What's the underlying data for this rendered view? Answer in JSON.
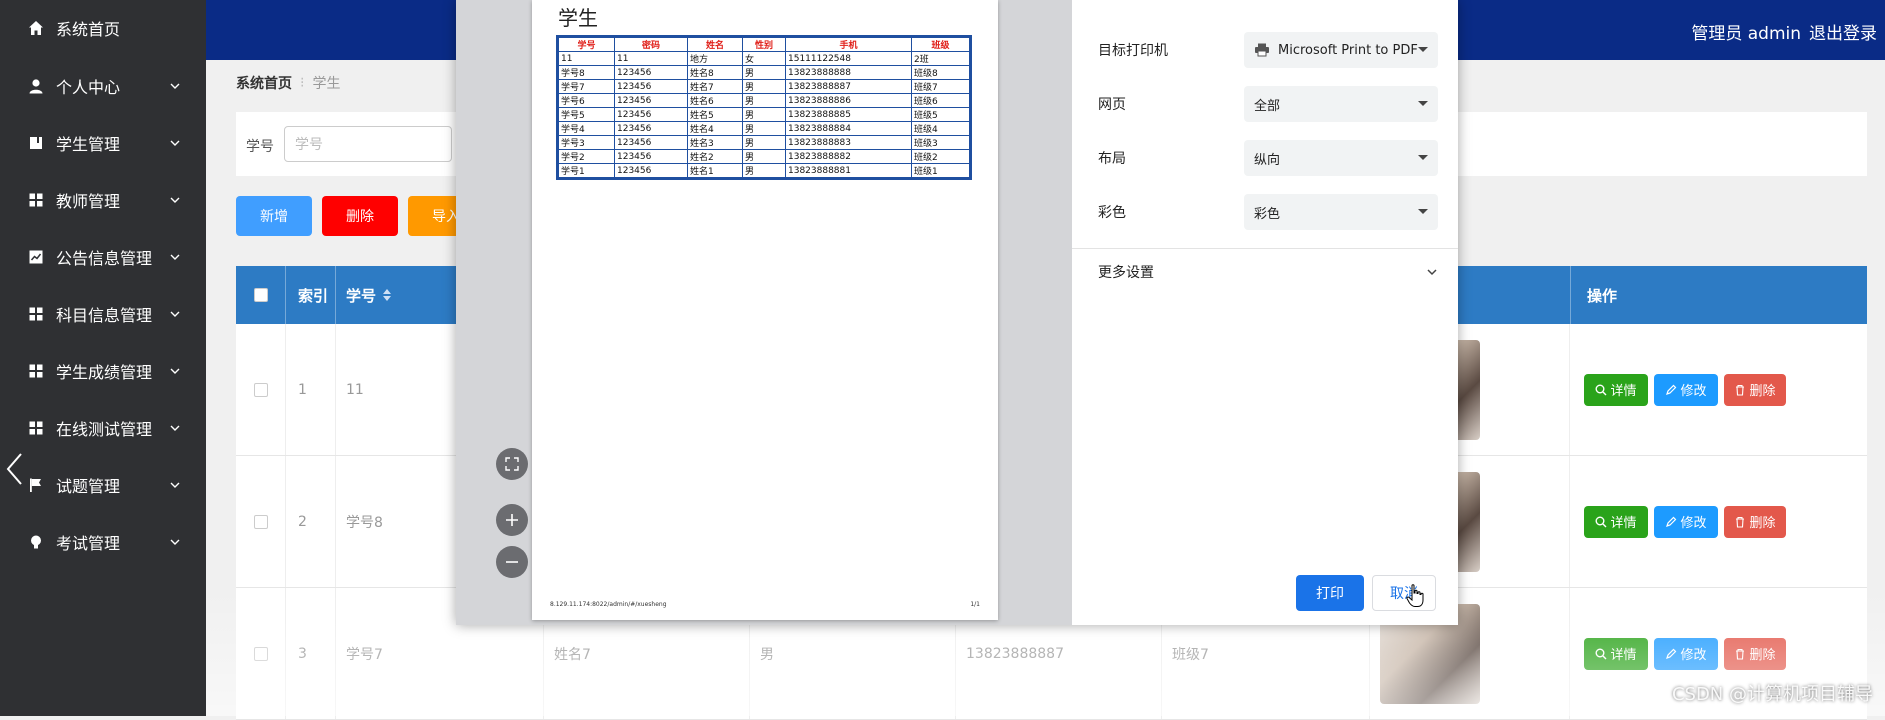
{
  "sidebar": {
    "items": [
      {
        "label": "系统首页",
        "icon": "home-icon"
      },
      {
        "label": "个人中心",
        "icon": "user-icon"
      },
      {
        "label": "学生管理",
        "icon": "book-icon"
      },
      {
        "label": "教师管理",
        "icon": "grid-icon"
      },
      {
        "label": "公告信息管理",
        "icon": "chart-icon"
      },
      {
        "label": "科目信息管理",
        "icon": "grid-icon"
      },
      {
        "label": "学生成绩管理",
        "icon": "grid-icon"
      },
      {
        "label": "在线测试管理",
        "icon": "grid-icon"
      },
      {
        "label": "试题管理",
        "icon": "flag-icon"
      },
      {
        "label": "考试管理",
        "icon": "bulb-icon"
      }
    ]
  },
  "header": {
    "user": "管理员 admin",
    "logout": "退出登录"
  },
  "breadcrumb": {
    "home": "系统首页",
    "current": "学生"
  },
  "search": {
    "label": "学号",
    "placeholder": "学号"
  },
  "actions": {
    "add": "新增",
    "delete": "删除",
    "import": "导入"
  },
  "table": {
    "headers": {
      "index": "索引",
      "xuehao": "学号",
      "ops": "操作"
    },
    "rows": [
      {
        "index": "1",
        "xuehao": "11",
        "name": "",
        "sex": "",
        "phone": "",
        "cls": ""
      },
      {
        "index": "2",
        "xuehao": "学号8",
        "name": "",
        "sex": "",
        "phone": "",
        "cls": ""
      },
      {
        "index": "3",
        "xuehao": "学号7",
        "name": "姓名7",
        "sex": "男",
        "phone": "13823888887",
        "cls": "班级7"
      }
    ],
    "op_labels": {
      "detail": "详情",
      "edit": "修改",
      "delete": "删除"
    }
  },
  "print": {
    "title": "学生",
    "columns": [
      "学号",
      "密码",
      "姓名",
      "性别",
      "手机",
      "班级"
    ],
    "rows": [
      [
        "11",
        "11",
        "地方",
        "女",
        "15111122548",
        "2班"
      ],
      [
        "学号8",
        "123456",
        "姓名8",
        "男",
        "13823888888",
        "班级8"
      ],
      [
        "学号7",
        "123456",
        "姓名7",
        "男",
        "13823888887",
        "班级7"
      ],
      [
        "学号6",
        "123456",
        "姓名6",
        "男",
        "13823888886",
        "班级6"
      ],
      [
        "学号5",
        "123456",
        "姓名5",
        "男",
        "13823888885",
        "班级5"
      ],
      [
        "学号4",
        "123456",
        "姓名4",
        "男",
        "13823888884",
        "班级4"
      ],
      [
        "学号3",
        "123456",
        "姓名3",
        "男",
        "13823888883",
        "班级3"
      ],
      [
        "学号2",
        "123456",
        "姓名2",
        "男",
        "13823888882",
        "班级2"
      ],
      [
        "学号1",
        "123456",
        "姓名1",
        "男",
        "13823888881",
        "班级1"
      ]
    ],
    "footer_url": "8.129.11.174:8022/admin/#/xuesheng",
    "footer_page": "1/1",
    "settings": {
      "printer_label": "目标打印机",
      "printer_value": "Microsoft Print to PDF",
      "pages_label": "网页",
      "pages_value": "全部",
      "layout_label": "布局",
      "layout_value": "纵向",
      "color_label": "彩色",
      "color_value": "彩色",
      "more_label": "更多设置"
    },
    "print_button": "打印",
    "cancel_button": "取消"
  },
  "watermark": "CSDN @计算机项目辅导"
}
